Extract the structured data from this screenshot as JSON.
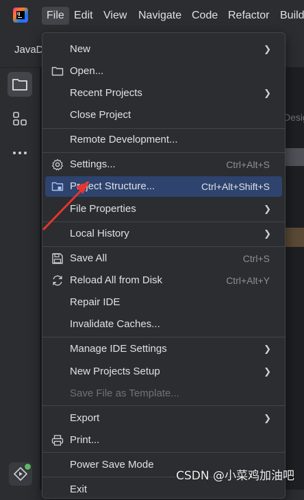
{
  "menubar": {
    "items": [
      {
        "label": "File"
      },
      {
        "label": "Edit"
      },
      {
        "label": "View"
      },
      {
        "label": "Navigate"
      },
      {
        "label": "Code"
      },
      {
        "label": "Refactor"
      },
      {
        "label": "Build"
      }
    ]
  },
  "tab": {
    "label": "JavaD"
  },
  "editor_hint": "Desig",
  "menu": {
    "new": {
      "label": "New"
    },
    "open": {
      "label": "Open..."
    },
    "recent": {
      "label": "Recent Projects"
    },
    "close": {
      "label": "Close Project"
    },
    "remote": {
      "label": "Remote Development..."
    },
    "settings": {
      "label": "Settings...",
      "shortcut": "Ctrl+Alt+S"
    },
    "project_structure": {
      "label": "Project Structure...",
      "shortcut": "Ctrl+Alt+Shift+S"
    },
    "file_properties": {
      "label": "File Properties"
    },
    "local_history": {
      "label": "Local History"
    },
    "save_all": {
      "label": "Save All",
      "shortcut": "Ctrl+S"
    },
    "reload": {
      "label": "Reload All from Disk",
      "shortcut": "Ctrl+Alt+Y"
    },
    "repair": {
      "label": "Repair IDE"
    },
    "invalidate": {
      "label": "Invalidate Caches..."
    },
    "manage_settings": {
      "label": "Manage IDE Settings"
    },
    "new_projects_setup": {
      "label": "New Projects Setup"
    },
    "save_template": {
      "label": "Save File as Template..."
    },
    "export": {
      "label": "Export"
    },
    "print": {
      "label": "Print..."
    },
    "power_save": {
      "label": "Power Save Mode"
    },
    "exit": {
      "label": "Exit"
    }
  },
  "icons": {
    "folder": "folder-icon",
    "structure": "structure-icon",
    "more": "more-icon",
    "gear": "gear-icon",
    "project": "project-structure-icon",
    "save": "save-icon",
    "reload": "reload-icon",
    "print": "print-icon",
    "run": "run-icon"
  },
  "colors": {
    "background": "#2b2d30",
    "highlight": "#2e436e",
    "text": "#dfe1e5",
    "shortcut": "#8c8f94",
    "disabled": "#6f737a",
    "annotation": "#e8352e"
  },
  "watermark": "CSDN @小菜鸡加油吧"
}
